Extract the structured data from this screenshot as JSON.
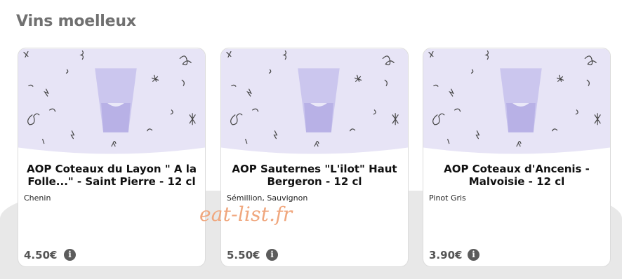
{
  "section": {
    "title": "Vins moelleux"
  },
  "products": [
    {
      "name": "AOP Coteaux du Layon \" A la Folle...\" - Saint Pierre - 12 cl",
      "grapes": "Chenin",
      "price": "4.50€"
    },
    {
      "name": "AOP Sauternes \"L'ilot\" Haut Bergeron - 12 cl",
      "grapes": "Sémillion, Sauvignon",
      "price": "5.50€"
    },
    {
      "name": "AOP Coteaux d'Ancenis - Malvoisie - 12 cl",
      "grapes": "Pinot Gris",
      "price": "3.90€"
    }
  ],
  "info_icon": {
    "glyph": "i",
    "icon": "info-icon"
  },
  "watermark": {
    "text": "eat-list.fr"
  },
  "colors": {
    "visual_bg": "#e7e4f6",
    "glass": "#cbc6ee",
    "doodle": "#444444",
    "watermark": "#f0a77e"
  }
}
